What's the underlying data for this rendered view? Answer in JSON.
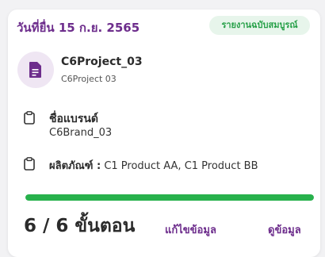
{
  "card": {
    "submit_date": "วันที่ยื่น 15 ก.ย. 2565",
    "status_badge": "รายงานฉบับสมบูรณ์",
    "project": {
      "name": "C6Project_03",
      "subtitle": "C6Project 03",
      "icon": "document-icon"
    },
    "brand": {
      "label": "ชื่อแบรนด์",
      "value": "C6Brand_03",
      "icon": "clipboard-icon"
    },
    "product": {
      "label": "ผลิตภัณฑ์ :",
      "value": "C1 Product AA, C1 Product BB",
      "icon": "clipboard-icon"
    },
    "progress": {
      "completed": 6,
      "total": 6,
      "fraction": 1.0,
      "text": "6 / 6 ขั้นตอน"
    },
    "actions": {
      "edit_label": "แก้ไขข้อมูล",
      "view_label": "ดูข้อมูล"
    }
  },
  "colors": {
    "accent": "#6d2d8c",
    "success": "#27b14c",
    "badge_bg": "#e7f5eb",
    "badge_text": "#26a048"
  }
}
